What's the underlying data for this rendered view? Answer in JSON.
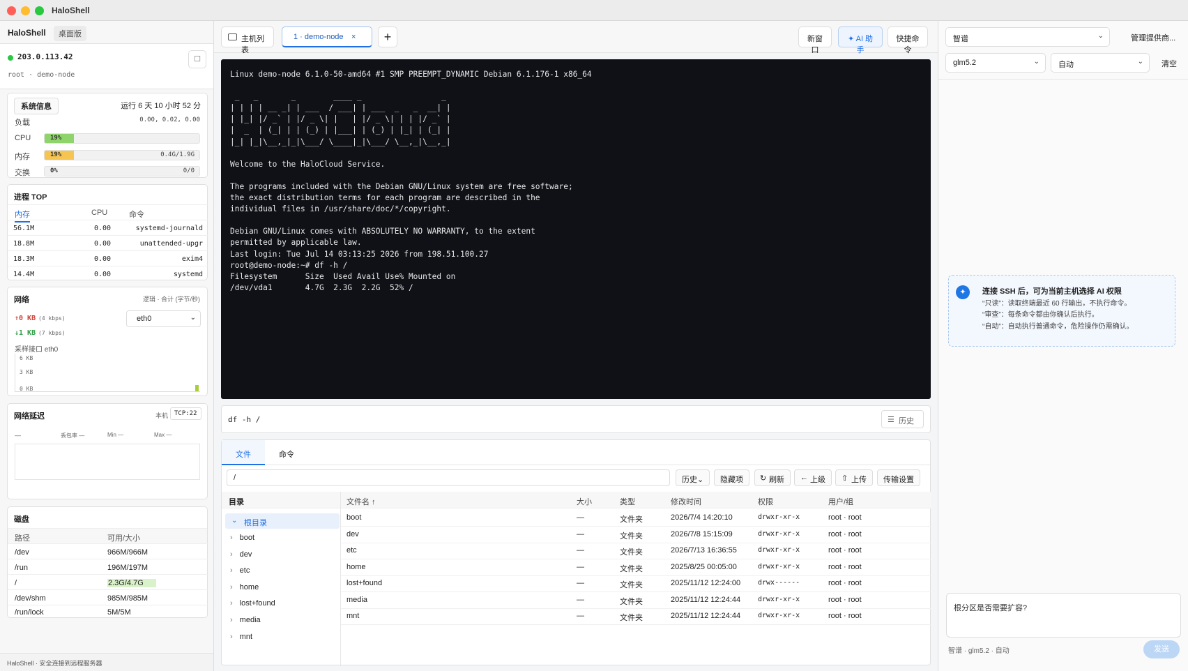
{
  "app": {
    "title": "HaloShell"
  },
  "sidebar": {
    "brand": "HaloShell",
    "edition": "桌面版",
    "host": {
      "ip": "203.0.113.42",
      "user_line": "root · demo-node"
    },
    "sysinfo": {
      "badge": "系统信息",
      "uptime": "运行 6 天 10 小时 52 分",
      "load_label": "负载",
      "load_value": "0.00, 0.02, 0.00",
      "cpu": {
        "label": "CPU",
        "pct": "19%",
        "value": 0.19,
        "right": ""
      },
      "mem": {
        "label": "内存",
        "pct": "19%",
        "value": 0.19,
        "right": "0.4G/1.9G"
      },
      "swap": {
        "label": "交换",
        "pct": "0%",
        "value": 0,
        "right": "0/0"
      }
    },
    "proc": {
      "title": "进程 TOP",
      "headers": [
        "内存",
        "CPU",
        "命令"
      ],
      "rows": [
        {
          "mem": "56.1M",
          "cpu": "0.00",
          "cmd": "systemd-journald"
        },
        {
          "mem": "18.8M",
          "cpu": "0.00",
          "cmd": "unattended-upgr"
        },
        {
          "mem": "18.3M",
          "cpu": "0.00",
          "cmd": "exim4"
        },
        {
          "mem": "14.4M",
          "cpu": "0.00",
          "cmd": "systemd"
        }
      ]
    },
    "net": {
      "title": "网络",
      "mode": "逻辑 · 合计 (字节/秒)",
      "up": "↑0 KB",
      "up_rate": "(4 kbps)",
      "down": "↓1 KB",
      "down_rate": "(7 kbps)",
      "iface_select": "eth0",
      "sample_label": "采样接口 eth0",
      "axis": [
        "6 KB",
        "3 KB",
        "0 KB"
      ]
    },
    "latency": {
      "title": "网络延迟",
      "local": "本机",
      "proto": "TCP:22",
      "stats": [
        "—",
        "丢包率 —",
        "Min —",
        "Max —"
      ]
    },
    "disk": {
      "title": "磁盘",
      "headers": [
        "路径",
        "可用/大小"
      ],
      "rows": [
        {
          "path": "/dev",
          "size": "966M/966M"
        },
        {
          "path": "/run",
          "size": "196M/197M"
        },
        {
          "path": "/",
          "size": "2.3G/4.7G"
        },
        {
          "path": "/dev/shm",
          "size": "985M/985M"
        },
        {
          "path": "/run/lock",
          "size": "5M/5M"
        }
      ]
    },
    "footer": "HaloShell · 安全连接到远程服务器"
  },
  "tabs": {
    "host_list": "主机列表",
    "active": "1 · demo-node",
    "new_window": "新窗口",
    "ai": "✦ AI 助手",
    "quick": "快捷命令"
  },
  "terminal": {
    "text": "Linux demo-node 6.1.0-50-amd64 #1 SMP PREEMPT_DYNAMIC Debian 6.1.176-1 x86_64\n\n _   _       _        ____ _                 _ \n| | | | __ _| | ___  / ___| | ___  _   _  __| |\n| |_| |/ _` | |/ _ \\| |   | |/ _ \\| | | |/ _` |\n|  _  | (_| | | (_) | |___| | (_) | |_| | (_| |\n|_| |_|\\__,_|_|\\___/ \\____|_|\\___/ \\__,_|\\__,_|\n\nWelcome to the HaloCloud Service.\n\nThe programs included with the Debian GNU/Linux system are free software;\nthe exact distribution terms for each program are described in the\nindividual files in /usr/share/doc/*/copyright.\n\nDebian GNU/Linux comes with ABSOLUTELY NO WARRANTY, to the extent\npermitted by applicable law.\nLast login: Tue Jul 14 03:13:25 2026 from 198.51.100.27\nroot@demo-node:~# df -h /\nFilesystem      Size  Used Avail Use% Mounted on\n/dev/vda1       4.7G  2.3G  2.2G  52% /"
  },
  "cmdbar": {
    "value": "df -h /",
    "history": "历史"
  },
  "files": {
    "tabs": [
      "文件",
      "命令"
    ],
    "path": "/",
    "buttons": {
      "history": "历史⌄",
      "hidden": "隐藏项",
      "refresh": "刷新",
      "up": "上级",
      "upload": "上传",
      "transfer": "传输设置"
    },
    "tree_title": "目录",
    "tree": [
      "根目录",
      "boot",
      "dev",
      "etc",
      "home",
      "lost+found",
      "media",
      "mnt"
    ],
    "headers": [
      "文件名 ↑",
      "大小",
      "类型",
      "修改时间",
      "权限",
      "用户/组"
    ],
    "rows": [
      {
        "name": "boot",
        "size": "—",
        "type": "文件夹",
        "mtime": "2026/7/4 14:20:10",
        "perm": "drwxr-xr-x",
        "owner": "root · root"
      },
      {
        "name": "dev",
        "size": "—",
        "type": "文件夹",
        "mtime": "2026/7/8 15:15:09",
        "perm": "drwxr-xr-x",
        "owner": "root · root"
      },
      {
        "name": "etc",
        "size": "—",
        "type": "文件夹",
        "mtime": "2026/7/13 16:36:55",
        "perm": "drwxr-xr-x",
        "owner": "root · root"
      },
      {
        "name": "home",
        "size": "—",
        "type": "文件夹",
        "mtime": "2025/8/25 00:05:00",
        "perm": "drwxr-xr-x",
        "owner": "root · root"
      },
      {
        "name": "lost+found",
        "size": "—",
        "type": "文件夹",
        "mtime": "2025/11/12 12:24:00",
        "perm": "drwx------",
        "owner": "root · root"
      },
      {
        "name": "media",
        "size": "—",
        "type": "文件夹",
        "mtime": "2025/11/12 12:24:44",
        "perm": "drwxr-xr-x",
        "owner": "root · root"
      },
      {
        "name": "mnt",
        "size": "—",
        "type": "文件夹",
        "mtime": "2025/11/12 12:24:44",
        "perm": "drwxr-xr-x",
        "owner": "root · root"
      }
    ]
  },
  "ai": {
    "provider": "智谱",
    "manage": "管理提供商...",
    "model": "glm5.2",
    "mode": "自动",
    "clear": "清空",
    "info_title": "连接 SSH 后，可为当前主机选择 AI 权限",
    "info_lines": [
      "“只读”：读取终端最近 60 行输出，不执行命令。",
      "“审查”：每条命令都由你确认后执行。",
      "“自动”：自动执行普通命令，危险操作仍需确认。"
    ],
    "input": "根分区是否需要扩容?",
    "status": "智谱 · glm5.2 · 自动",
    "send": "发送"
  },
  "colors": {
    "accent": "#1f6fe5",
    "cpu_bar": "#8fd46a",
    "mem_bar": "#f5c451",
    "terminal_bg": "#0f1117"
  }
}
